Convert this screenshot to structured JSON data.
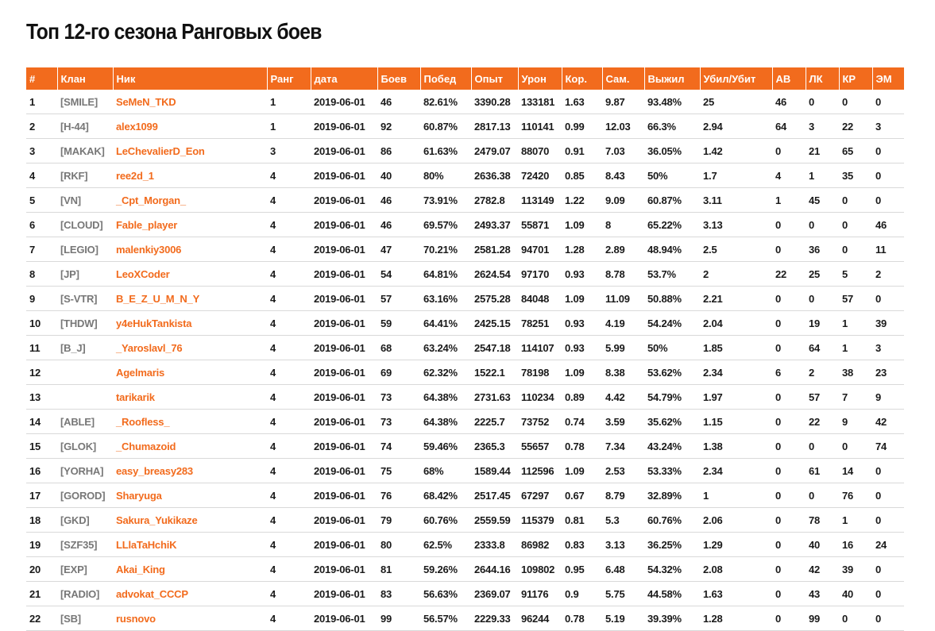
{
  "page_title": "Топ 12-го сезона Ранговых боев",
  "colors": {
    "accent": "#f26b1d",
    "clan_text": "#777777"
  },
  "columns": [
    "#",
    "Клан",
    "Ник",
    "Ранг",
    "дата",
    "Боев",
    "Побед",
    "Опыт",
    "Урон",
    "Кор.",
    "Сам.",
    "Выжил",
    "Убил/Убит",
    "АВ",
    "ЛК",
    "КР",
    "ЭМ"
  ],
  "rows": [
    [
      "1",
      "[SMILE]",
      "SeMeN_TKD",
      "1",
      "2019-06-01",
      "46",
      "82.61%",
      "3390.28",
      "133181",
      "1.63",
      "9.87",
      "93.48%",
      "25",
      "46",
      "0",
      "0",
      "0"
    ],
    [
      "2",
      "[H-44]",
      "alex1099",
      "1",
      "2019-06-01",
      "92",
      "60.87%",
      "2817.13",
      "110141",
      "0.99",
      "12.03",
      "66.3%",
      "2.94",
      "64",
      "3",
      "22",
      "3"
    ],
    [
      "3",
      "[MAKAK]",
      "LeChevalierD_Eon",
      "3",
      "2019-06-01",
      "86",
      "61.63%",
      "2479.07",
      "88070",
      "0.91",
      "7.03",
      "36.05%",
      "1.42",
      "0",
      "21",
      "65",
      "0"
    ],
    [
      "4",
      "[RKF]",
      "ree2d_1",
      "4",
      "2019-06-01",
      "40",
      "80%",
      "2636.38",
      "72420",
      "0.85",
      "8.43",
      "50%",
      "1.7",
      "4",
      "1",
      "35",
      "0"
    ],
    [
      "5",
      "[VN]",
      "_Cpt_Morgan_",
      "4",
      "2019-06-01",
      "46",
      "73.91%",
      "2782.8",
      "113149",
      "1.22",
      "9.09",
      "60.87%",
      "3.11",
      "1",
      "45",
      "0",
      "0"
    ],
    [
      "6",
      "[CLOUD]",
      "Fable_player",
      "4",
      "2019-06-01",
      "46",
      "69.57%",
      "2493.37",
      "55871",
      "1.09",
      "8",
      "65.22%",
      "3.13",
      "0",
      "0",
      "0",
      "46"
    ],
    [
      "7",
      "[LEGIO]",
      "malenkiy3006",
      "4",
      "2019-06-01",
      "47",
      "70.21%",
      "2581.28",
      "94701",
      "1.28",
      "2.89",
      "48.94%",
      "2.5",
      "0",
      "36",
      "0",
      "11"
    ],
    [
      "8",
      "[JP]",
      "LeoXCoder",
      "4",
      "2019-06-01",
      "54",
      "64.81%",
      "2624.54",
      "97170",
      "0.93",
      "8.78",
      "53.7%",
      "2",
      "22",
      "25",
      "5",
      "2"
    ],
    [
      "9",
      "[S-VTR]",
      "B_E_Z_U_M_N_Y",
      "4",
      "2019-06-01",
      "57",
      "63.16%",
      "2575.28",
      "84048",
      "1.09",
      "11.09",
      "50.88%",
      "2.21",
      "0",
      "0",
      "57",
      "0"
    ],
    [
      "10",
      "[THDW]",
      "y4eHukTankista",
      "4",
      "2019-06-01",
      "59",
      "64.41%",
      "2425.15",
      "78251",
      "0.93",
      "4.19",
      "54.24%",
      "2.04",
      "0",
      "19",
      "1",
      "39"
    ],
    [
      "11",
      "[B_J]",
      "_Yaroslavl_76",
      "4",
      "2019-06-01",
      "68",
      "63.24%",
      "2547.18",
      "114107",
      "0.93",
      "5.99",
      "50%",
      "1.85",
      "0",
      "64",
      "1",
      "3"
    ],
    [
      "12",
      "",
      "Agelmaris",
      "4",
      "2019-06-01",
      "69",
      "62.32%",
      "1522.1",
      "78198",
      "1.09",
      "8.38",
      "53.62%",
      "2.34",
      "6",
      "2",
      "38",
      "23"
    ],
    [
      "13",
      "",
      "tarikarik",
      "4",
      "2019-06-01",
      "73",
      "64.38%",
      "2731.63",
      "110234",
      "0.89",
      "4.42",
      "54.79%",
      "1.97",
      "0",
      "57",
      "7",
      "9"
    ],
    [
      "14",
      "[ABLE]",
      "_Roofless_",
      "4",
      "2019-06-01",
      "73",
      "64.38%",
      "2225.7",
      "73752",
      "0.74",
      "3.59",
      "35.62%",
      "1.15",
      "0",
      "22",
      "9",
      "42"
    ],
    [
      "15",
      "[GLOK]",
      "_Chumazoid",
      "4",
      "2019-06-01",
      "74",
      "59.46%",
      "2365.3",
      "55657",
      "0.78",
      "7.34",
      "43.24%",
      "1.38",
      "0",
      "0",
      "0",
      "74"
    ],
    [
      "16",
      "[YORHA]",
      "easy_breasy283",
      "4",
      "2019-06-01",
      "75",
      "68%",
      "1589.44",
      "112596",
      "1.09",
      "2.53",
      "53.33%",
      "2.34",
      "0",
      "61",
      "14",
      "0"
    ],
    [
      "17",
      "[GOROD]",
      "Sharyuga",
      "4",
      "2019-06-01",
      "76",
      "68.42%",
      "2517.45",
      "67297",
      "0.67",
      "8.79",
      "32.89%",
      "1",
      "0",
      "0",
      "76",
      "0"
    ],
    [
      "18",
      "[GKD]",
      "Sakura_Yukikaze",
      "4",
      "2019-06-01",
      "79",
      "60.76%",
      "2559.59",
      "115379",
      "0.81",
      "5.3",
      "60.76%",
      "2.06",
      "0",
      "78",
      "1",
      "0"
    ],
    [
      "19",
      "[SZF35]",
      "LLlaTaHchiK",
      "4",
      "2019-06-01",
      "80",
      "62.5%",
      "2333.8",
      "86982",
      "0.83",
      "3.13",
      "36.25%",
      "1.29",
      "0",
      "40",
      "16",
      "24"
    ],
    [
      "20",
      "[EXP]",
      "Akai_King",
      "4",
      "2019-06-01",
      "81",
      "59.26%",
      "2644.16",
      "109802",
      "0.95",
      "6.48",
      "54.32%",
      "2.08",
      "0",
      "42",
      "39",
      "0"
    ],
    [
      "21",
      "[RADIO]",
      "advokat_CCCP",
      "4",
      "2019-06-01",
      "83",
      "56.63%",
      "2369.07",
      "91176",
      "0.9",
      "5.75",
      "44.58%",
      "1.63",
      "0",
      "43",
      "40",
      "0"
    ],
    [
      "22",
      "[SB]",
      "rusnovo",
      "4",
      "2019-06-01",
      "99",
      "56.57%",
      "2229.33",
      "96244",
      "0.78",
      "5.19",
      "39.39%",
      "1.28",
      "0",
      "99",
      "0",
      "0"
    ]
  ]
}
